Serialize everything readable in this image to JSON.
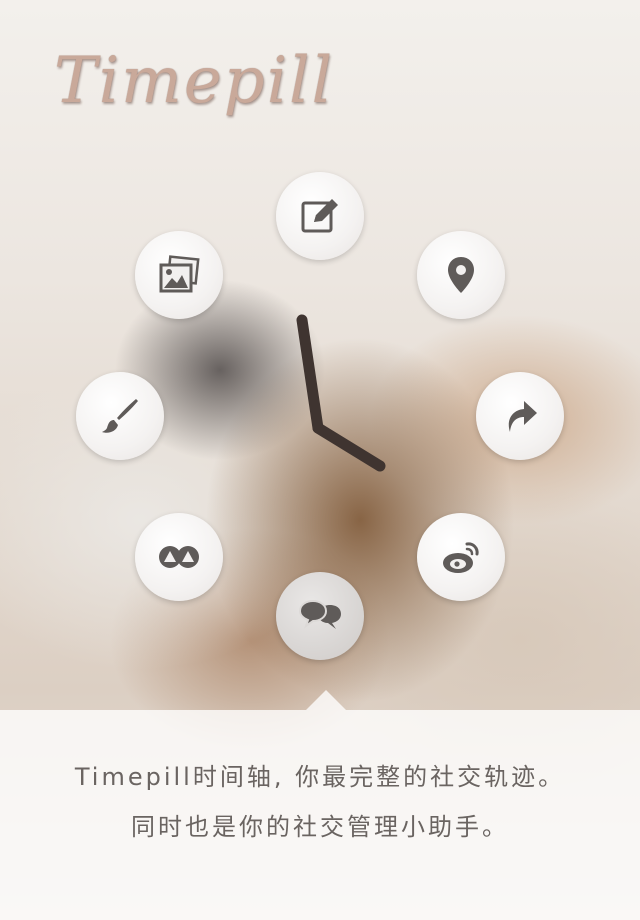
{
  "app": {
    "logo_text": "Timepill"
  },
  "menu": {
    "items": [
      {
        "name": "write",
        "icon": "edit-icon"
      },
      {
        "name": "location",
        "icon": "location-pin-icon"
      },
      {
        "name": "share",
        "icon": "share-arrow-icon"
      },
      {
        "name": "weibo",
        "icon": "weibo-icon"
      },
      {
        "name": "chat",
        "icon": "chat-bubbles-icon",
        "active": true
      },
      {
        "name": "social",
        "icon": "social-icon"
      },
      {
        "name": "draw",
        "icon": "brush-icon"
      },
      {
        "name": "gallery",
        "icon": "photos-icon"
      }
    ]
  },
  "clock": {
    "icon": "clock-hands"
  },
  "caption": {
    "line1": "Timepill时间轴, 你最完整的社交轨迹。",
    "line2": "同时也是你的社交管理小助手。"
  },
  "colors": {
    "icon": "#5f5b59",
    "clock_hands": "#3f3430",
    "logo": "#c9a99a"
  }
}
